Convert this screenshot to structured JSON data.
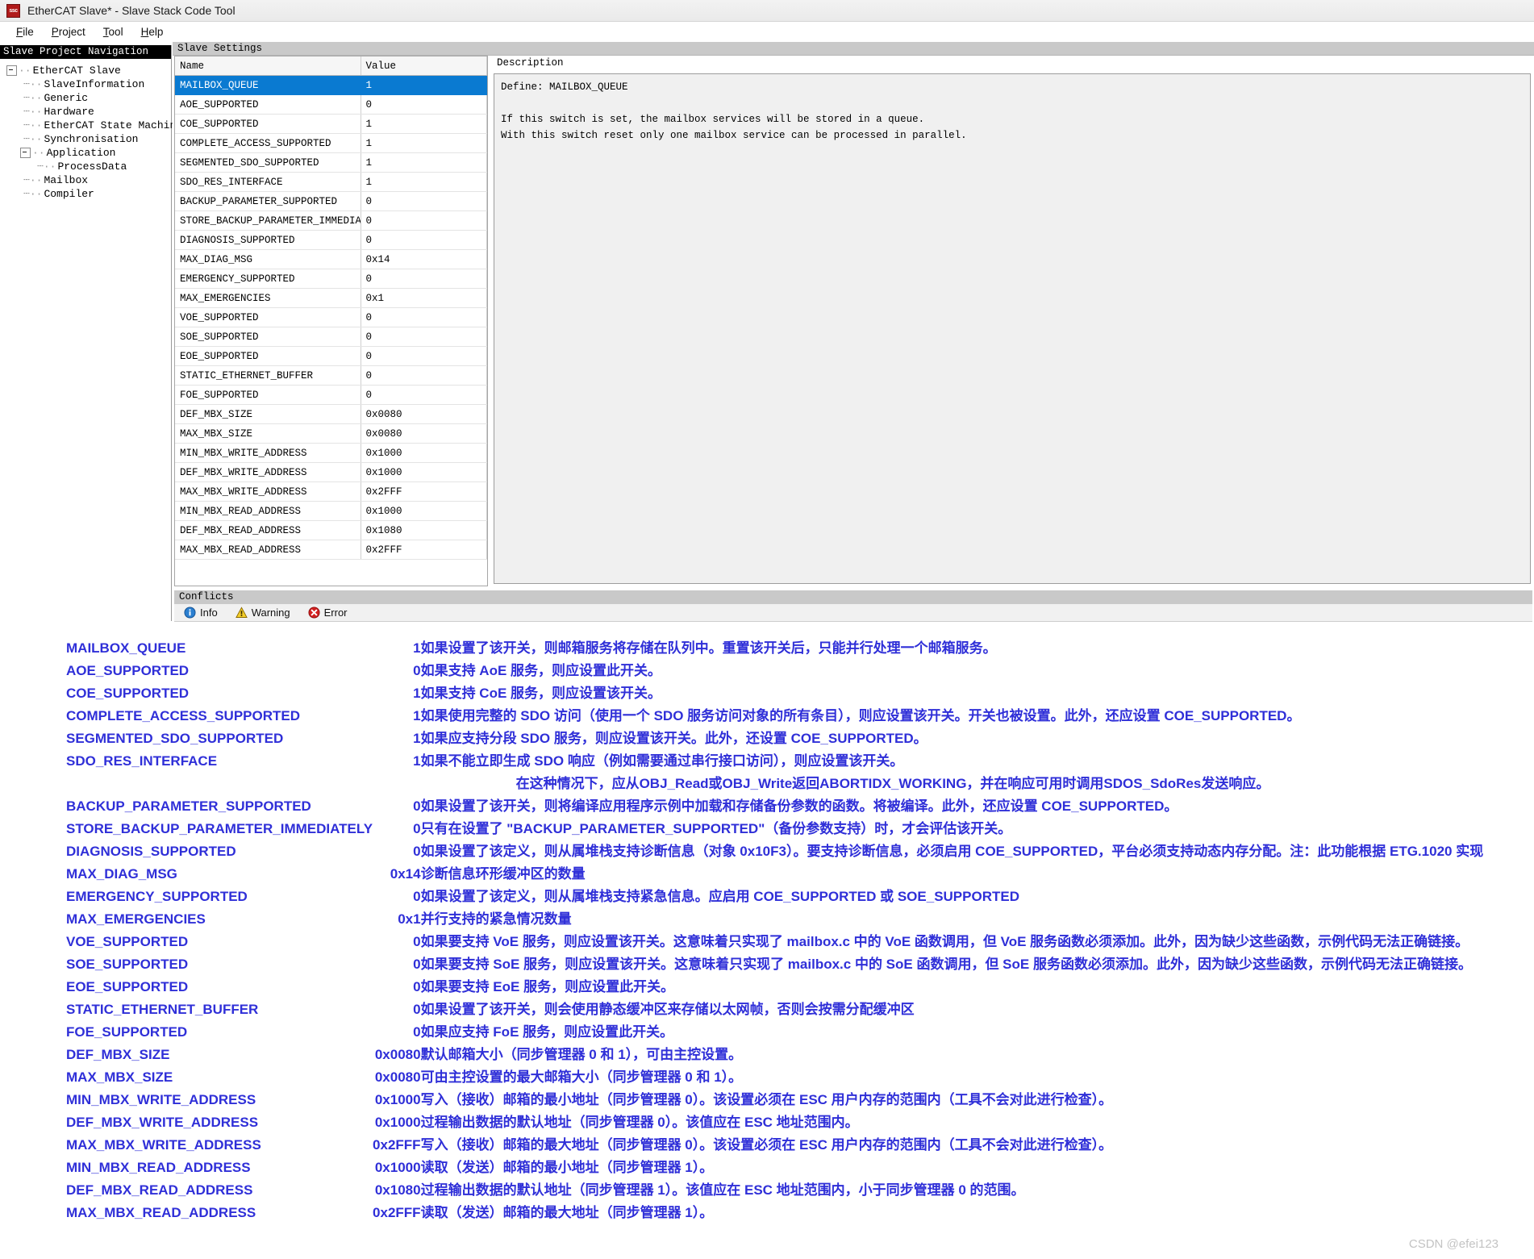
{
  "window": {
    "app_icon_text": "ssc",
    "title": "EtherCAT Slave* - Slave Stack Code Tool",
    "menus": [
      {
        "label": "File",
        "accel": "F"
      },
      {
        "label": "Project",
        "accel": "P"
      },
      {
        "label": "Tool",
        "accel": "T"
      },
      {
        "label": "Help",
        "accel": "H"
      }
    ]
  },
  "navigation": {
    "header": "Slave Project Navigation",
    "items": [
      {
        "label": "EtherCAT Slave",
        "depth": 0,
        "expander": true
      },
      {
        "label": "SlaveInformation",
        "depth": 1,
        "expander": false
      },
      {
        "label": "Generic",
        "depth": 1,
        "expander": false
      },
      {
        "label": "Hardware",
        "depth": 1,
        "expander": false
      },
      {
        "label": "EtherCAT State Machine",
        "depth": 1,
        "expander": false
      },
      {
        "label": "Synchronisation",
        "depth": 1,
        "expander": false
      },
      {
        "label": "Application",
        "depth": 1,
        "expander": true
      },
      {
        "label": "ProcessData",
        "depth": 2,
        "expander": false
      },
      {
        "label": "Mailbox",
        "depth": 1,
        "expander": false
      },
      {
        "label": "Compiler",
        "depth": 1,
        "expander": false
      }
    ]
  },
  "settings": {
    "caption": "Slave Settings",
    "columns": [
      "Name",
      "Value"
    ],
    "rows": [
      {
        "name": "MAILBOX_QUEUE",
        "value": "1",
        "selected": true
      },
      {
        "name": "AOE_SUPPORTED",
        "value": "0",
        "selected": false
      },
      {
        "name": "COE_SUPPORTED",
        "value": "1",
        "selected": false
      },
      {
        "name": "COMPLETE_ACCESS_SUPPORTED",
        "value": "1",
        "selected": false
      },
      {
        "name": "SEGMENTED_SDO_SUPPORTED",
        "value": "1",
        "selected": false
      },
      {
        "name": "SDO_RES_INTERFACE",
        "value": "1",
        "selected": false
      },
      {
        "name": "BACKUP_PARAMETER_SUPPORTED",
        "value": "0",
        "selected": false
      },
      {
        "name": "STORE_BACKUP_PARAMETER_IMMEDIATELY",
        "value": "0",
        "selected": false
      },
      {
        "name": "DIAGNOSIS_SUPPORTED",
        "value": "0",
        "selected": false
      },
      {
        "name": "MAX_DIAG_MSG",
        "value": "0x14",
        "selected": false
      },
      {
        "name": "EMERGENCY_SUPPORTED",
        "value": "0",
        "selected": false
      },
      {
        "name": "MAX_EMERGENCIES",
        "value": "0x1",
        "selected": false
      },
      {
        "name": "VOE_SUPPORTED",
        "value": "0",
        "selected": false
      },
      {
        "name": "SOE_SUPPORTED",
        "value": "0",
        "selected": false
      },
      {
        "name": "EOE_SUPPORTED",
        "value": "0",
        "selected": false
      },
      {
        "name": "STATIC_ETHERNET_BUFFER",
        "value": "0",
        "selected": false
      },
      {
        "name": "FOE_SUPPORTED",
        "value": "0",
        "selected": false
      },
      {
        "name": "DEF_MBX_SIZE",
        "value": "0x0080",
        "selected": false
      },
      {
        "name": "MAX_MBX_SIZE",
        "value": "0x0080",
        "selected": false
      },
      {
        "name": "MIN_MBX_WRITE_ADDRESS",
        "value": "0x1000",
        "selected": false
      },
      {
        "name": "DEF_MBX_WRITE_ADDRESS",
        "value": "0x1000",
        "selected": false
      },
      {
        "name": "MAX_MBX_WRITE_ADDRESS",
        "value": "0x2FFF",
        "selected": false
      },
      {
        "name": "MIN_MBX_READ_ADDRESS",
        "value": "0x1000",
        "selected": false
      },
      {
        "name": "DEF_MBX_READ_ADDRESS",
        "value": "0x1080",
        "selected": false
      },
      {
        "name": "MAX_MBX_READ_ADDRESS",
        "value": "0x2FFF",
        "selected": false
      }
    ]
  },
  "description": {
    "label": "Description",
    "text": "Define: MAILBOX_QUEUE\n\nIf this switch is set, the mailbox services will be stored in a queue.\nWith this switch reset only one mailbox service can be processed in parallel."
  },
  "conflicts": {
    "caption": "Conflicts",
    "filters": [
      {
        "label": "Info",
        "icon": "info-icon",
        "color": "#1a6fc4"
      },
      {
        "label": "Warning",
        "icon": "warning-icon",
        "color": "#f2c21b"
      },
      {
        "label": "Error",
        "icon": "error-icon",
        "color": "#cc1414"
      }
    ]
  },
  "annotations": {
    "accent_color": "#2f2fd8",
    "rows": [
      {
        "key": "MAILBOX_QUEUE",
        "value": "1",
        "desc": "如果设置了该开关，则邮箱服务将存储在队列中。重置该开关后，只能并行处理一个邮箱服务。"
      },
      {
        "key": "AOE_SUPPORTED",
        "value": "0",
        "desc": "如果支持 AoE 服务，则应设置此开关。"
      },
      {
        "key": "COE_SUPPORTED",
        "value": "1",
        "desc": "如果支持 CoE 服务，则应设置该开关。"
      },
      {
        "key": "COMPLETE_ACCESS_SUPPORTED",
        "value": "1",
        "desc": "如果使用完整的 SDO 访问（使用一个 SDO 服务访问对象的所有条目），则应设置该开关。开关也被设置。此外，还应设置 COE_SUPPORTED。"
      },
      {
        "key": "SEGMENTED_SDO_SUPPORTED",
        "value": "1",
        "desc": " 如果应支持分段 SDO 服务，则应设置该开关。此外，还设置 COE_SUPPORTED。"
      },
      {
        "key": "SDO_RES_INTERFACE",
        "value": "1",
        "desc": "如果不能立即生成 SDO 响应（例如需要通过串行接口访问），则应设置该开关。"
      },
      {
        "key": "",
        "value": "",
        "desc": "在这种情况下，应从OBJ_Read或OBJ_Write返回ABORTIDX_WORKING，并在响应可用时调用SDOS_SdoRes发送响应。",
        "continuation": true
      },
      {
        "key": "BACKUP_PARAMETER_SUPPORTED",
        "value": "0",
        "desc": "如果设置了该开关，则将编译应用程序示例中加载和存储备份参数的函数。将被编译。此外，还应设置 COE_SUPPORTED。"
      },
      {
        "key": "STORE_BACKUP_PARAMETER_IMMEDIATELY",
        "value": "0",
        "desc": "    只有在设置了 \"BACKUP_PARAMETER_SUPPORTED\"（备份参数支持）时，才会评估该开关。"
      },
      {
        "key": "DIAGNOSIS_SUPPORTED",
        "value": "0",
        "desc": "如果设置了该定义，则从属堆栈支持诊断信息（对象 0x10F3）。要支持诊断信息，必须启用 COE_SUPPORTED，平台必须支持动态内存分配。注：此功能根据 ETG.1020 实现"
      },
      {
        "key": "MAX_DIAG_MSG",
        "value": "0x14",
        "desc": "诊断信息环形缓冲区的数量"
      },
      {
        "key": "EMERGENCY_SUPPORTED",
        "value": "0",
        "desc": "如果设置了该定义，则从属堆栈支持紧急信息。应启用 COE_SUPPORTED 或 SOE_SUPPORTED"
      },
      {
        "key": "MAX_EMERGENCIES",
        "value": "0x1",
        "desc": "并行支持的紧急情况数量"
      },
      {
        "key": "VOE_SUPPORTED",
        "value": "0",
        "desc": "如果要支持 VoE 服务，则应设置该开关。这意味着只实现了 mailbox.c 中的 VoE 函数调用，但 VoE 服务函数必须添加。此外，因为缺少这些函数，示例代码无法正确链接。"
      },
      {
        "key": "SOE_SUPPORTED",
        "value": "0",
        "desc": "如果要支持 SoE 服务，则应设置该开关。这意味着只实现了 mailbox.c 中的 SoE 函数调用，但 SoE 服务函数必须添加。此外，因为缺少这些函数，示例代码无法正确链接。"
      },
      {
        "key": "EOE_SUPPORTED",
        "value": "0",
        "desc": "如果要支持 EoE 服务，则应设置此开关。"
      },
      {
        "key": "STATIC_ETHERNET_BUFFER",
        "value": "0",
        "desc": "如果设置了该开关，则会使用静态缓冲区来存储以太网帧，否则会按需分配缓冲区"
      },
      {
        "key": "FOE_SUPPORTED",
        "value": "0",
        "desc": "如果应支持 FoE 服务，则应设置此开关。"
      },
      {
        "key": "DEF_MBX_SIZE",
        "value": "0x0080",
        "desc": "默认邮箱大小（同步管理器 0 和 1），可由主控设置。"
      },
      {
        "key": "MAX_MBX_SIZE",
        "value": "0x0080",
        "desc": "可由主控设置的最大邮箱大小（同步管理器 0 和 1）。"
      },
      {
        "key": "MIN_MBX_WRITE_ADDRESS",
        "value": "0x1000",
        "desc": "写入（接收）邮箱的最小地址（同步管理器 0）。该设置必须在 ESC 用户内存的范围内（工具不会对此进行检查）。"
      },
      {
        "key": "DEF_MBX_WRITE_ADDRESS",
        "value": "0x1000",
        "desc": "过程输出数据的默认地址（同步管理器 0）。该值应在 ESC 地址范围内。"
      },
      {
        "key": "MAX_MBX_WRITE_ADDRESS",
        "value": "0x2FFF",
        "desc": "写入（接收）邮箱的最大地址（同步管理器 0）。该设置必须在 ESC 用户内存的范围内（工具不会对此进行检查）。"
      },
      {
        "key": "MIN_MBX_READ_ADDRESS",
        "value": "0x1000",
        "desc": "读取（发送）邮箱的最小地址（同步管理器 1）。"
      },
      {
        "key": "DEF_MBX_READ_ADDRESS",
        "value": "0x1080",
        "desc": "过程输出数据的默认地址（同步管理器 1）。该值应在 ESC 地址范围内，小于同步管理器 0 的范围。"
      },
      {
        "key": "MAX_MBX_READ_ADDRESS",
        "value": "0x2FFF",
        "desc": "读取（发送）邮箱的最大地址（同步管理器 1）。"
      }
    ]
  },
  "watermark": "CSDN @efei123"
}
